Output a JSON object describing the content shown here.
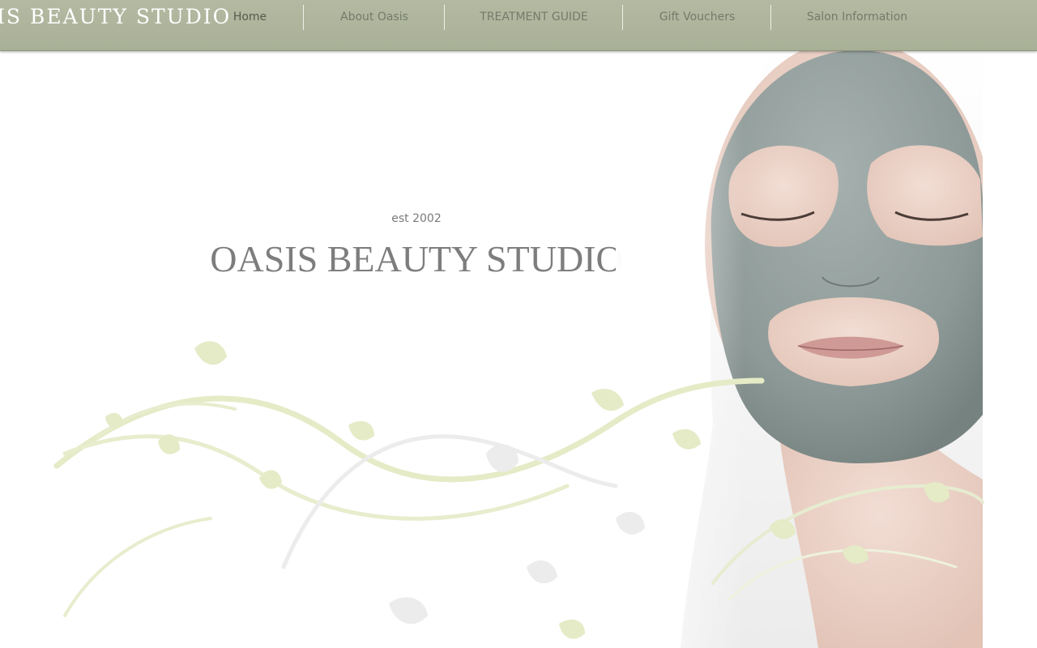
{
  "site": {
    "brand": "IS BEAUTY STUDIO"
  },
  "nav": {
    "items": [
      {
        "label": "Home"
      },
      {
        "label": "About Oasis"
      },
      {
        "label": "TREATMENT GUIDE"
      },
      {
        "label": "Gift Vouchers"
      },
      {
        "label": "Salon Information"
      }
    ]
  },
  "hero": {
    "tagline": "est 2002",
    "title": "OASIS BEAUTY STUDIO"
  },
  "theme": {
    "header_color": "#aeb59c",
    "title_color": "#7d7d7d",
    "mask_color": "#8e9a98",
    "vine_color": "#e3ebc2"
  },
  "image": {
    "subject": "woman-with-clay-face-mask"
  }
}
